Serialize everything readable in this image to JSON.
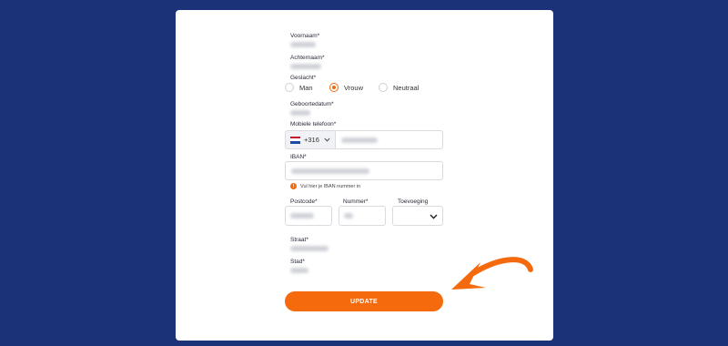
{
  "form": {
    "first_name_label": "Voornaam*",
    "last_name_label": "Achternaam*",
    "gender_label": "Geslacht*",
    "gender_options": [
      "Man",
      "Vrouw",
      "Neutraal"
    ],
    "gender_selected": "Vrouw",
    "birthdate_label": "Geboortedatum*",
    "mobile_label": "Mobiele telefoon*",
    "phone_prefix": "+316",
    "iban_label": "IBAN*",
    "iban_hint": "Vul hier je IBAN nummer in",
    "postcode_label": "Postcode*",
    "number_label": "Nummer*",
    "addition_label": "Toevoeging",
    "street_label": "Straat*",
    "city_label": "Stad*",
    "update_button": "UPDATE"
  },
  "colors": {
    "background": "#1c3278",
    "accent": "#f56a0d",
    "card": "#ffffff"
  },
  "icons": {
    "flag": "netherlands-flag-icon",
    "chevron": "chevron-down-icon",
    "hint": "exclamation-icon",
    "arrow": "pointing-arrow-icon"
  }
}
